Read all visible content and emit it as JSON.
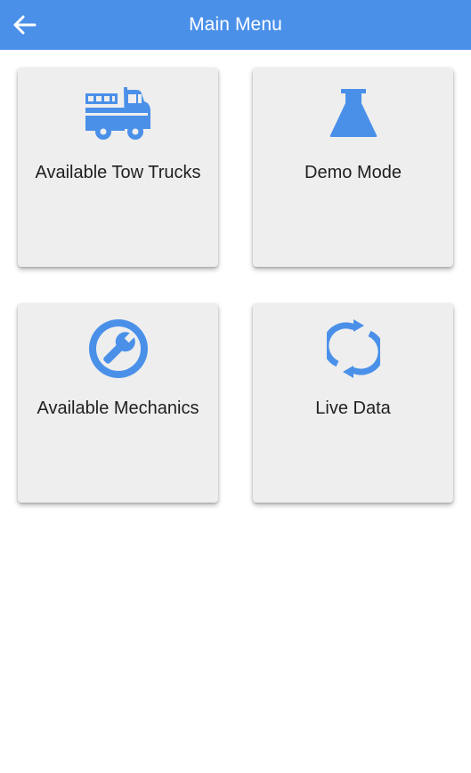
{
  "appbar": {
    "title": "Main Menu",
    "back_icon": "arrow-left-icon",
    "background": "#4a90e9"
  },
  "menu": {
    "accent_color": "#4a90e9",
    "tiles": [
      {
        "label": "Available Tow Trucks",
        "icon": "fire-truck-icon"
      },
      {
        "label": "Demo Mode",
        "icon": "flask-icon"
      },
      {
        "label": "Available Mechanics",
        "icon": "wrench-icon"
      },
      {
        "label": "Live Data",
        "icon": "sync-icon"
      }
    ]
  }
}
